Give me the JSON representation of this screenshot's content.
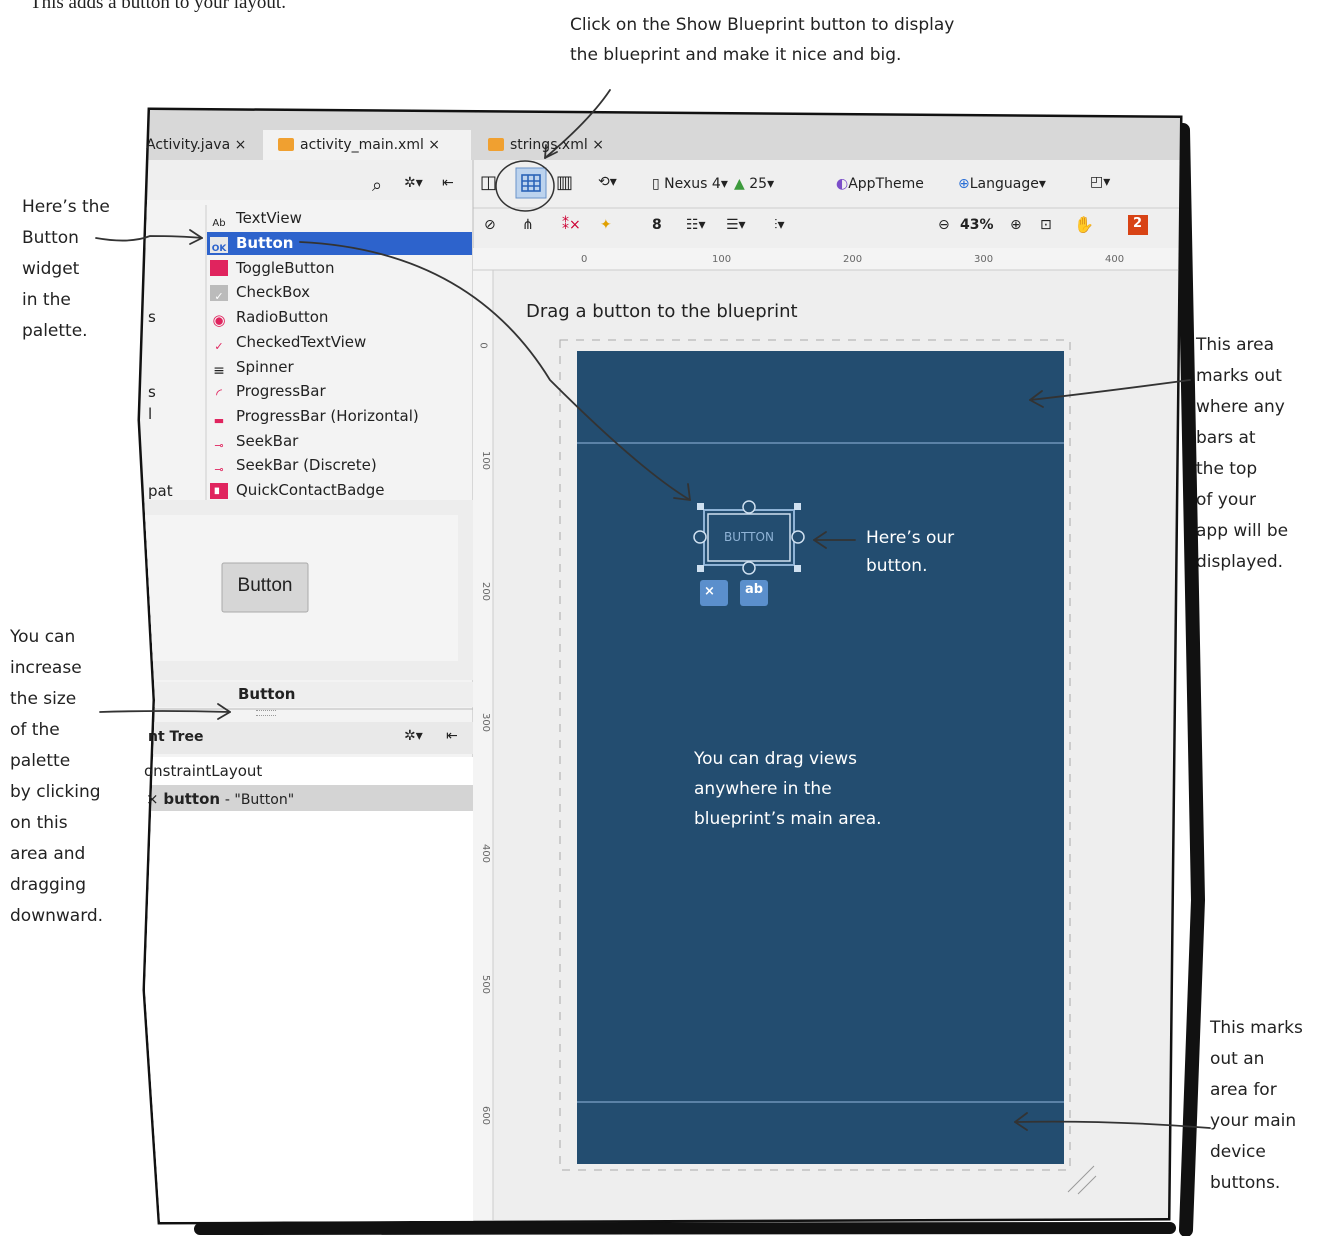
{
  "intro": "This adds a button to your layout.",
  "tabs": [
    {
      "label": "Activity.java ×"
    },
    {
      "label": "activity_main.xml ×"
    },
    {
      "label": "strings.xml ×"
    }
  ],
  "toolbar": {
    "device": "Nexus 4",
    "api": "25",
    "theme": "AppTheme",
    "language": "Language",
    "margin": "8",
    "zoom": "43%",
    "errors": "2"
  },
  "palette": {
    "items": [
      {
        "label": "TextView",
        "icon": "textview-icon"
      },
      {
        "label": "Button",
        "icon": "button-icon"
      },
      {
        "label": "ToggleButton",
        "icon": "toggle-icon"
      },
      {
        "label": "CheckBox",
        "icon": "checkbox-icon"
      },
      {
        "label": "RadioButton",
        "icon": "radio-icon"
      },
      {
        "label": "CheckedTextView",
        "icon": "checked-text-icon"
      },
      {
        "label": "Spinner",
        "icon": "spinner-icon"
      },
      {
        "label": "ProgressBar",
        "icon": "progress-icon"
      },
      {
        "label": "ProgressBar (Horizontal)",
        "icon": "progress-horizontal-icon"
      },
      {
        "label": "SeekBar",
        "icon": "seekbar-icon"
      },
      {
        "label": "SeekBar (Discrete)",
        "icon": "seekbar-discrete-icon"
      },
      {
        "label": "QuickContactBadge",
        "icon": "contact-badge-icon"
      }
    ],
    "categories": [
      "s",
      "s",
      "l",
      "pat"
    ],
    "preview_button": "Button",
    "preview_label": "Button"
  },
  "component_tree": {
    "title": "nt Tree",
    "rows": [
      "onstraintLayout",
      "button",
      "- \"Button\""
    ]
  },
  "ruler": {
    "h": [
      "0",
      "100",
      "200",
      "300",
      "400"
    ],
    "v": [
      "0",
      "100",
      "200",
      "300",
      "400",
      "500",
      "600"
    ]
  },
  "design": {
    "heading": "Drag a button to the blueprint",
    "button_text": "BUTTON",
    "constraint_icon": "×",
    "baseline_icon": "ab"
  },
  "annotations": {
    "show_blueprint": "Click on the Show Blueprint button to display\nthe blueprint and make it nice and big.",
    "button_widget": "Here’s the\nButton\nwidget\nin the\npalette.",
    "increase_size": "You can\nincrease\nthe size\nof the\npalette\nby clicking\non this\narea and\ndragging\ndownward.",
    "top_bars": "This area\nmarks out\nwhere any\nbars at\nthe top\nof your\napp will be\ndisplayed.",
    "our_button": "Here’s our\nbutton.",
    "drag_views": "You can drag views\nanywhere in the\nblueprint’s main area.",
    "device_buttons": "This marks\nout an\narea for\nyour main\ndevice\nbuttons."
  },
  "colors": {
    "blueprint": "#234d70",
    "selection": "#2d63cc",
    "panel": "#f0f0f0"
  }
}
